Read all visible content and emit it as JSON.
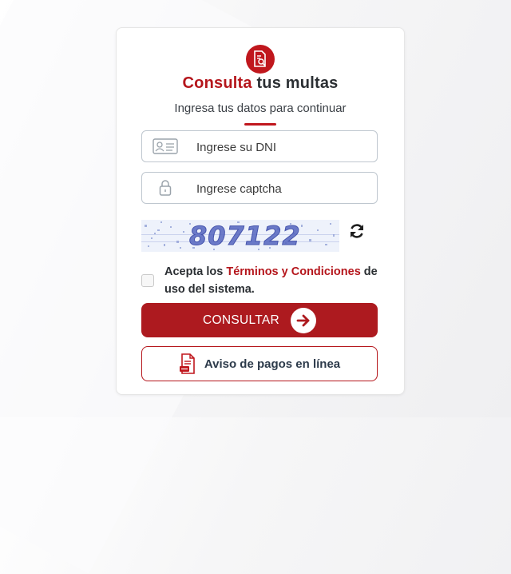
{
  "header": {
    "title_accent": "Consulta",
    "title_rest": " tus multas",
    "subtitle": "Ingresa tus datos para continuar",
    "logo_icon": "document-search-icon"
  },
  "form": {
    "dni_placeholder": "Ingrese su DNI",
    "captcha_placeholder": "Ingrese captcha",
    "captcha_code": "807122",
    "refresh_icon": "refresh-icon"
  },
  "terms": {
    "prefix": "Acepta los ",
    "link1": "Términos",
    "mid": " y ",
    "link2": "Condiciones",
    "suffix": " de uso del sistema."
  },
  "actions": {
    "consultar_label": "CONSULTAR",
    "aviso_label": "Aviso de pagos en línea"
  },
  "colors": {
    "brand_red": "#ad1a1f",
    "text_dark": "#2b2f33"
  }
}
